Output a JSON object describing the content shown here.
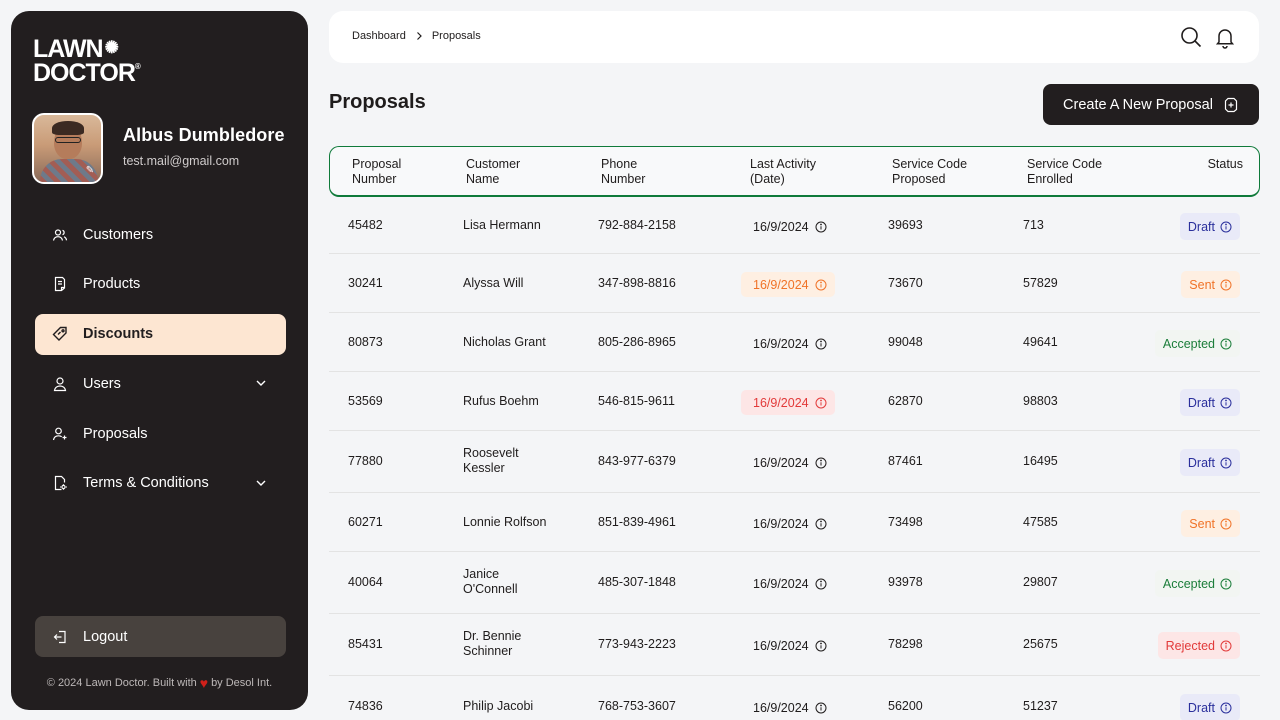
{
  "brand": {
    "line1": "LAWN",
    "line2": "DOCTOR",
    "trademark": "®"
  },
  "profile": {
    "name": "Albus Dumbledore",
    "email": "test.mail@gmail.com"
  },
  "sidebar": {
    "items": [
      {
        "label": "Customers",
        "icon": "users-icon"
      },
      {
        "label": "Products",
        "icon": "document-icon"
      },
      {
        "label": "Discounts",
        "icon": "tag-icon",
        "active": true
      },
      {
        "label": "Users",
        "icon": "user-icon",
        "expandable": true
      },
      {
        "label": "Proposals",
        "icon": "user-plus-icon"
      },
      {
        "label": "Terms & Conditions",
        "icon": "file-settings-icon",
        "expandable": true
      }
    ],
    "logout": "Logout"
  },
  "footer": {
    "prefix": "© 2024 Lawn Doctor. Built with",
    "suffix": "by Desol Int."
  },
  "breadcrumb": {
    "root": "Dashboard",
    "current": "Proposals"
  },
  "page": {
    "title": "Proposals",
    "create_label": "Create A New Proposal"
  },
  "table": {
    "headers": {
      "number": [
        "Proposal",
        "Number"
      ],
      "customer": [
        "Customer",
        "Name"
      ],
      "phone": [
        "Phone",
        "Number"
      ],
      "activity": [
        "Last Activity",
        "(Date)"
      ],
      "proposed": [
        "Service Code",
        "Proposed"
      ],
      "enrolled": [
        "Service Code",
        "Enrolled"
      ],
      "status": [
        "Status"
      ]
    },
    "rows": [
      {
        "number": "45482",
        "customer": [
          "Lisa Hermann"
        ],
        "phone": "792-884-2158",
        "date": "16/9/2024",
        "date_state": "normal",
        "proposed": "39693",
        "enrolled": "713",
        "status": "Draft"
      },
      {
        "number": "30241",
        "customer": [
          "Alyssa Will"
        ],
        "phone": "347-898-8816",
        "date": "16/9/2024",
        "date_state": "hot",
        "proposed": "73670",
        "enrolled": "57829",
        "status": "Sent"
      },
      {
        "number": "80873",
        "customer": [
          "Nicholas Grant"
        ],
        "phone": "805-286-8965",
        "date": "16/9/2024",
        "date_state": "normal",
        "proposed": "99048",
        "enrolled": "49641",
        "status": "Accepted"
      },
      {
        "number": "53569",
        "customer": [
          "Rufus Boehm"
        ],
        "phone": "546-815-9611",
        "date": "16/9/2024",
        "date_state": "late",
        "proposed": "62870",
        "enrolled": "98803",
        "status": "Draft"
      },
      {
        "number": "77880",
        "customer": [
          "Roosevelt",
          "Kessler"
        ],
        "phone": "843-977-6379",
        "date": "16/9/2024",
        "date_state": "normal",
        "proposed": "87461",
        "enrolled": "16495",
        "status": "Draft"
      },
      {
        "number": "60271",
        "customer": [
          "Lonnie Rolfson"
        ],
        "phone": "851-839-4961",
        "date": "16/9/2024",
        "date_state": "normal",
        "proposed": "73498",
        "enrolled": "47585",
        "status": "Sent"
      },
      {
        "number": "40064",
        "customer": [
          "Janice",
          "O'Connell"
        ],
        "phone": "485-307-1848",
        "date": "16/9/2024",
        "date_state": "normal",
        "proposed": "93978",
        "enrolled": "29807",
        "status": "Accepted"
      },
      {
        "number": "85431",
        "customer": [
          "Dr. Bennie",
          "Schinner"
        ],
        "phone": "773-943-2223",
        "date": "16/9/2024",
        "date_state": "normal",
        "proposed": "78298",
        "enrolled": "25675",
        "status": "Rejected"
      },
      {
        "number": "74836",
        "customer": [
          "Philip Jacobi"
        ],
        "phone": "768-753-3607",
        "date": "16/9/2024",
        "date_state": "normal",
        "proposed": "56200",
        "enrolled": "51237",
        "status": "Draft"
      }
    ]
  },
  "colors": {
    "sidebar": "#221e1f",
    "active_nav": "#fde6d2",
    "header_border": "#0f7a3a",
    "draft": "#2a2f9c",
    "sent": "#f07328",
    "accepted": "#1b7d3a",
    "rejected": "#e23a3a"
  }
}
